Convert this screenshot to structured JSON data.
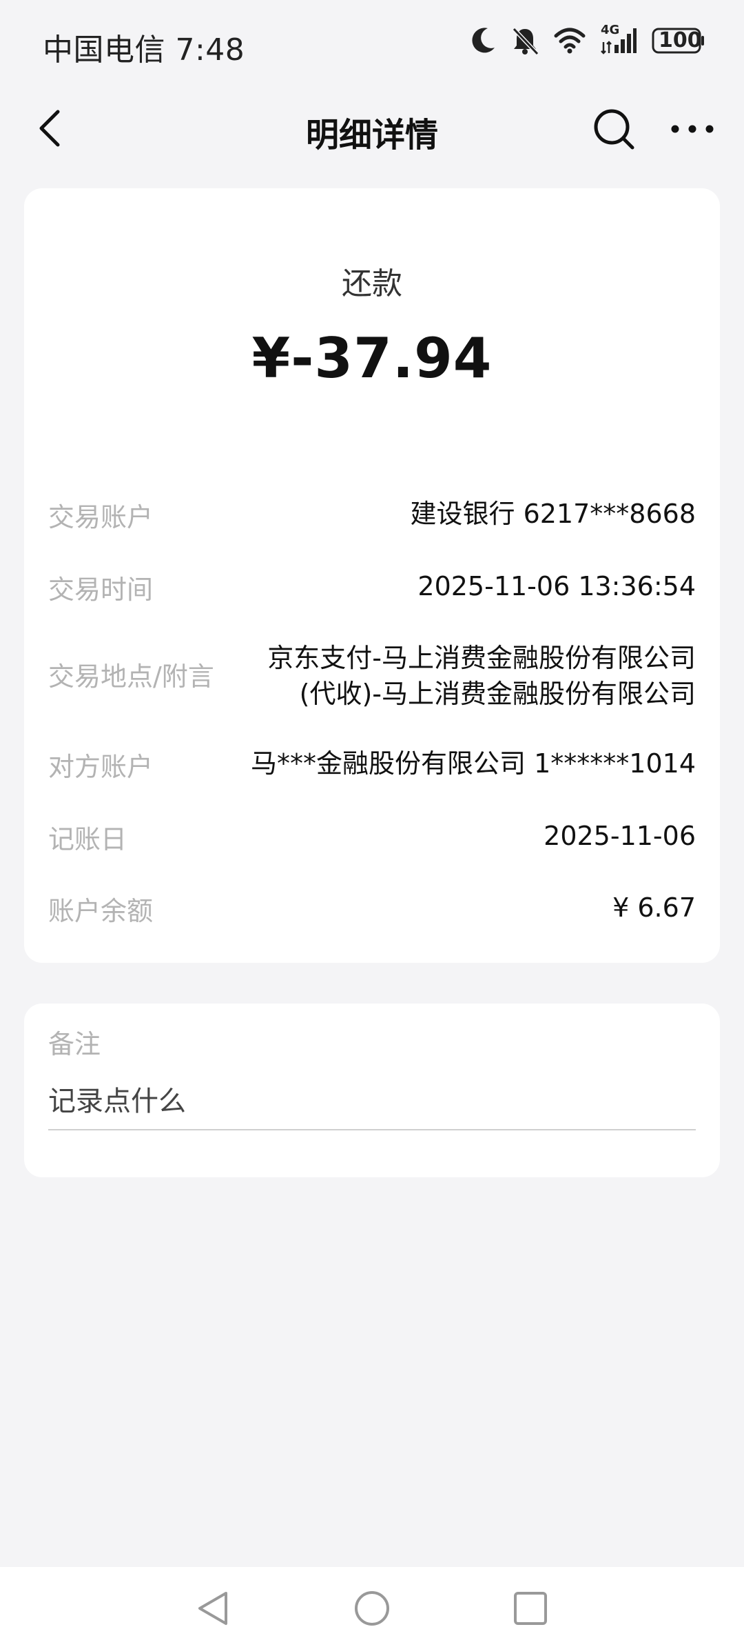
{
  "status_bar": {
    "carrier_time": "中国电信 7:48",
    "network": "4G",
    "battery": "100",
    "icons": [
      "moon-icon",
      "bell-off-icon",
      "wifi-icon",
      "signal-icon",
      "battery-icon"
    ]
  },
  "header": {
    "title": "明细详情",
    "back_icon": "chevron-left-icon",
    "search_icon": "search-icon",
    "more_icon": "more-horizontal-icon"
  },
  "transaction": {
    "type": "还款",
    "amount": "¥-37.94",
    "rows": [
      {
        "label": "交易账户",
        "value": "建设银行 6217***8668"
      },
      {
        "label": "交易时间",
        "value": "2025-11-06 13:36:54"
      },
      {
        "label": "交易地点/附言",
        "value": "京东支付-马上消费金融股份有限公司(代收)-马上消费金融股份有限公司"
      },
      {
        "label": "对方账户",
        "value": "马***金融股份有限公司 1******1014"
      },
      {
        "label": "记账日",
        "value": "2025-11-06"
      },
      {
        "label": "账户余额",
        "value": "¥ 6.67"
      }
    ]
  },
  "remark": {
    "label": "备注",
    "placeholder": "记录点什么"
  },
  "nav_bar": {
    "icons": [
      "back-triangle-icon",
      "home-circle-icon",
      "recents-square-icon"
    ]
  },
  "colors": {
    "background": "#f4f4f6",
    "card": "#ffffff",
    "label_gray": "#b3b3b3",
    "text": "#111111"
  }
}
